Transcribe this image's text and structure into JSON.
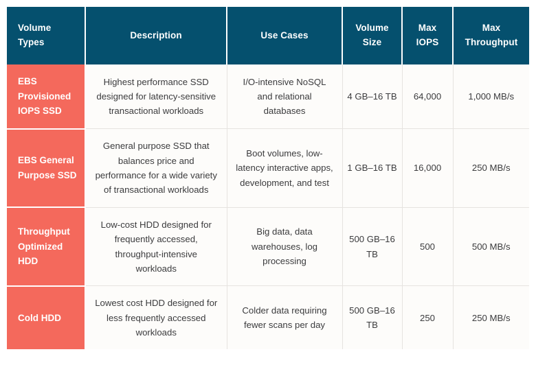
{
  "table": {
    "header": {
      "columns": [
        "Volume Types",
        "Description",
        "Use Cases",
        "Volume Size",
        "Max IOPS",
        "Max Throughput"
      ]
    },
    "colors": {
      "header_background": "#05506e",
      "header_text": "#ffffff",
      "volume_type_background": "#f4695c",
      "volume_type_text": "#ffffff",
      "cell_background": "#fdfcfa",
      "cell_text": "#3b3b3d",
      "grid_line": "#e6e3e0"
    },
    "rows": [
      {
        "volume_type": "EBS Provisioned IOPS SSD",
        "description": "Highest performance SSD designed for latency-sensitive transactional workloads",
        "use_cases": "I/O-intensive NoSQL and relational databases",
        "volume_size": "4 GB–16 TB",
        "max_iops": "64,000",
        "max_throughput": "1,000 MB/s"
      },
      {
        "volume_type": "EBS General Purpose SSD",
        "description": "General purpose SSD that balances price and performance for a wide variety of transactional workloads",
        "use_cases": "Boot volumes, low-latency interactive apps, development, and test",
        "volume_size": "1 GB–16 TB",
        "max_iops": "16,000",
        "max_throughput": "250 MB/s"
      },
      {
        "volume_type": "Throughput Optimized HDD",
        "description": "Low-cost HDD designed for frequently accessed, throughput-intensive workloads",
        "use_cases": "Big data, data warehouses, log processing",
        "volume_size": "500 GB–16 TB",
        "max_iops": "500",
        "max_throughput": "500 MB/s"
      },
      {
        "volume_type": "Cold HDD",
        "description": "Lowest cost HDD designed for less frequently accessed workloads",
        "use_cases": "Colder data requiring fewer scans per day",
        "volume_size": "500 GB–16 TB",
        "max_iops": "250",
        "max_throughput": "250 MB/s"
      }
    ]
  }
}
